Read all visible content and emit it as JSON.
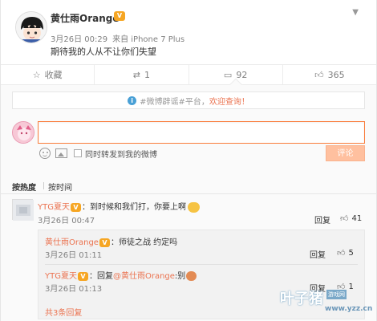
{
  "post": {
    "user_name": "黄仕雨Orange",
    "vip_badge": "V",
    "time": "3月26日 00:29",
    "source": "来自 iPhone 7 Plus",
    "text": "期待我的人从不让你们失望",
    "caret": "▼"
  },
  "actions": [
    {
      "label": "收藏",
      "icon": "star-icon"
    },
    {
      "label": "1",
      "icon": "repost-icon"
    },
    {
      "label": "92",
      "icon": "comment-icon"
    },
    {
      "label": "365",
      "icon": "like-icon"
    }
  ],
  "notice": {
    "prefix": "#微博辟谣#平台，",
    "highlight": "欢迎查询！",
    "icon": "info-icon"
  },
  "composer": {
    "repost_label": "同时转发到我的微博",
    "submit_label": "评论",
    "submit_color": "#ffc09f"
  },
  "sort": {
    "hot": "按热度",
    "time": "按时间"
  },
  "comments": [
    {
      "user": "YTG夏天",
      "text": "：到时候和我们打，你要上啊",
      "time": "3月26日 00:47",
      "reply_label": "回复",
      "likes": "41"
    }
  ],
  "replies": [
    {
      "user": "黄仕雨Orange",
      "text": "：师徒之战 约定吗",
      "time": "3月26日 01:11",
      "reply_label": "回复",
      "likes": "5"
    },
    {
      "user": "YTG夏天",
      "prefix": "：回复",
      "mention": "@黄仕雨Orange",
      "suffix": ":别",
      "time": "3月26日 01:13",
      "reply_label": "回复",
      "likes": "1"
    }
  ],
  "more_replies": "共3条回复",
  "watermark": {
    "name": "叶子猪",
    "tag": "游戏网",
    "url": "www.yzz.cn"
  },
  "colors": {
    "accent": "#eb7350",
    "input_border": "#fa7d3c",
    "vip": "#f6a623"
  }
}
